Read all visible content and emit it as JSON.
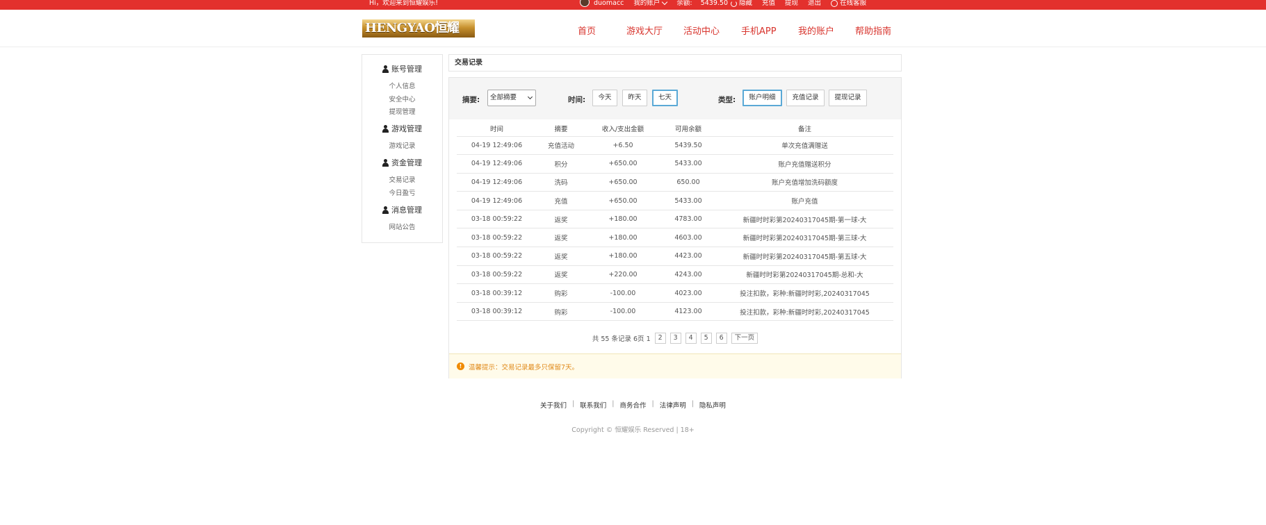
{
  "topbar": {
    "welcome": "Hi，欢迎来到恒耀娱乐!",
    "username": "duomacc",
    "my_account": "我的账户",
    "balance_label": "余额:",
    "balance_value": "5439.50",
    "hide_label": "隐藏",
    "recharge": "充值",
    "withdraw": "提现",
    "logout": "退出",
    "online_service": "在线客服"
  },
  "header": {
    "logo_text": "HENGYAO恒耀",
    "nav": [
      "首页",
      "游戏大厅",
      "活动中心",
      "手机APP",
      "我的账户",
      "帮助指南"
    ]
  },
  "sidebar": {
    "groups": [
      {
        "title": "账号管理",
        "items": [
          "个人信息",
          "安全中心",
          "提现管理"
        ]
      },
      {
        "title": "游戏管理",
        "items": [
          "游戏记录"
        ]
      },
      {
        "title": "资金管理",
        "items": [
          "交易记录",
          "今日盈亏"
        ]
      },
      {
        "title": "消息管理",
        "items": [
          "网站公告"
        ]
      }
    ]
  },
  "main": {
    "breadcrumb": "交易记录",
    "filters": {
      "summary_label": "摘要:",
      "summary_selected": "全部摘要",
      "time_label": "时间:",
      "time_options": [
        "今天",
        "昨天",
        "七天"
      ],
      "type_label": "类型:",
      "type_options": [
        "账户明细",
        "充值记录",
        "提现记录"
      ]
    },
    "table": {
      "headers": [
        "时间",
        "摘要",
        "收入/支出金额",
        "可用余额",
        "备注"
      ],
      "rows": [
        [
          "04-19 12:49:06",
          "充值活动",
          "+6.50",
          "5439.50",
          "单次充值满赠送"
        ],
        [
          "04-19 12:49:06",
          "积分",
          "+650.00",
          "5433.00",
          "账户充值赠送积分"
        ],
        [
          "04-19 12:49:06",
          "洗码",
          "+650.00",
          "650.00",
          "账户充值增加洗码额度"
        ],
        [
          "04-19 12:49:06",
          "充值",
          "+650.00",
          "5433.00",
          "账户充值"
        ],
        [
          "03-18 00:59:22",
          "返奖",
          "+180.00",
          "4783.00",
          "新疆时时彩第20240317045期-第一球-大"
        ],
        [
          "03-18 00:59:22",
          "返奖",
          "+180.00",
          "4603.00",
          "新疆时时彩第20240317045期-第三球-大"
        ],
        [
          "03-18 00:59:22",
          "返奖",
          "+180.00",
          "4423.00",
          "新疆时时彩第20240317045期-第五球-大"
        ],
        [
          "03-18 00:59:22",
          "返奖",
          "+220.00",
          "4243.00",
          "新疆时时彩第20240317045期-总和-大"
        ],
        [
          "03-18 00:39:12",
          "购彩",
          "-100.00",
          "4023.00",
          "投注扣款，彩种:新疆时时彩,20240317045"
        ],
        [
          "03-18 00:39:12",
          "购彩",
          "-100.00",
          "4123.00",
          "投注扣款，彩种:新疆时时彩,20240317045"
        ]
      ]
    },
    "pager": {
      "summary": "共 55 条记录 6页 1",
      "pages": [
        "2",
        "3",
        "4",
        "5",
        "6"
      ],
      "next": "下一页"
    },
    "notice": "温馨提示：交易记录最多只保留7天。"
  },
  "footer": {
    "links": [
      "关于我们",
      "联系我们",
      "商务合作",
      "法律声明",
      "隐私声明"
    ],
    "copyright": "Copyright © 恒耀娱乐 Reserved | 18+"
  }
}
